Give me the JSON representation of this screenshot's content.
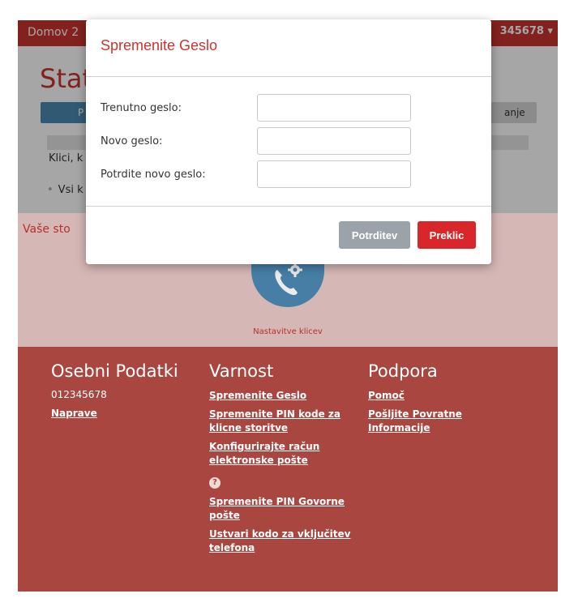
{
  "navbar": {
    "home_label": "Domov 2",
    "user_label": "345678 ▾"
  },
  "page": {
    "title": "Stat",
    "tab_left_label": "P",
    "tab_right_label": "anje",
    "calls_text": "Klici, k",
    "bullet_text": "Vsi k"
  },
  "services": {
    "title": "Vaše sto",
    "call_settings_label": "Nastavitve klicev"
  },
  "footer": {
    "personal": {
      "heading": "Osebni Podatki",
      "number": "012345678",
      "devices_link": "Naprave"
    },
    "security": {
      "heading": "Varnost",
      "links": [
        "Spremenite Geslo",
        "Spremenite PIN kode za klicne storitve",
        "Konfigurirajte račun elektronske pošte",
        "Spremenite PIN Govorne pošte",
        "Ustvari kodo za vključitev telefona"
      ],
      "help_glyph": "?"
    },
    "support": {
      "heading": "Podpora",
      "links": [
        "Pomoč",
        "Pošljite Povratne Informacije"
      ]
    }
  },
  "modal": {
    "title": "Spremenite Geslo",
    "current_label": "Trenutno geslo:",
    "current_value": "",
    "new_label": "Novo geslo:",
    "new_value": "",
    "confirm_label": "Potrdite novo geslo:",
    "confirm_value": "",
    "confirm_button": "Potrditev",
    "cancel_button": "Preklic"
  },
  "icons": {
    "call_settings": "phone-gear-icon",
    "help": "question-circle-icon"
  },
  "colors": {
    "brand_red": "#c9342e",
    "footer_red": "#a9463f",
    "accent_blue": "#4d89b3",
    "cancel_red": "#d9262b",
    "confirm_grey": "#9aa3aa"
  }
}
